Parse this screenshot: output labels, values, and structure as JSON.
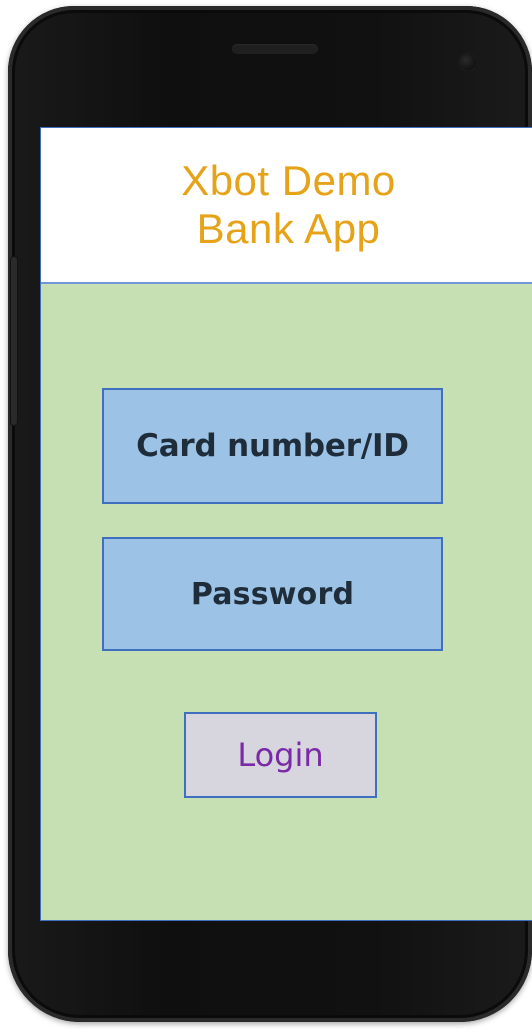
{
  "app": {
    "title": "Xbot Demo\nBank App"
  },
  "form": {
    "card_label": "Card number/ID",
    "password_label": "Password",
    "login_label": "Login"
  },
  "colors": {
    "header_text": "#e6a31a",
    "screen_background": "#c6e0b4",
    "field_background": "#9cc2e6",
    "field_border": "#3f6fbf",
    "button_background": "#d7d6df",
    "button_text": "#7a2aa6"
  }
}
